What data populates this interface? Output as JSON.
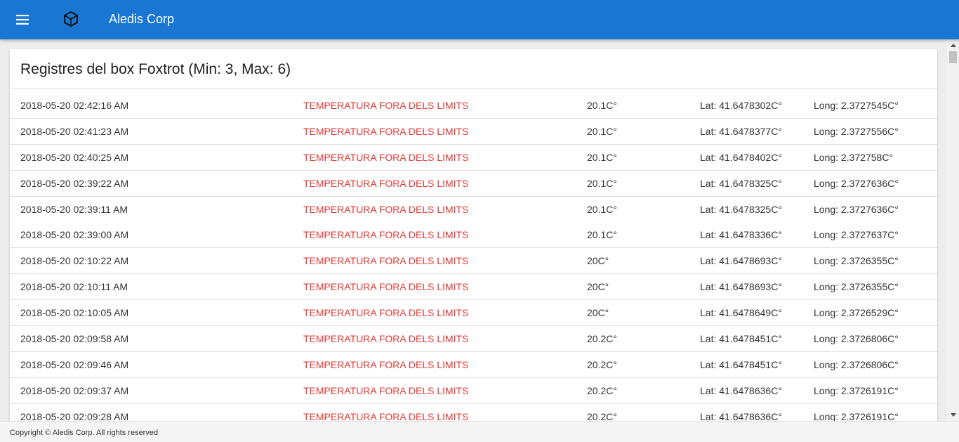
{
  "appbar": {
    "title": "Aledis Corp",
    "menu_icon": "hamburger-menu-icon",
    "logo_icon": "cube-icon",
    "color": "#1976d2"
  },
  "card": {
    "title": "Registres del box Foxtrot (Min: 3, Max: 6)"
  },
  "records": [
    {
      "date": "2018-05-20 02:42:16 AM",
      "status": "TEMPERATURA FORA DELS LIMITS",
      "temp": "20.1C°",
      "lat": "Lat: 41.6478302C°",
      "long": "Long: 2.3727545C°"
    },
    {
      "date": "2018-05-20 02:41:23 AM",
      "status": "TEMPERATURA FORA DELS LIMITS",
      "temp": "20.1C°",
      "lat": "Lat: 41.6478377C°",
      "long": "Long: 2.3727556C°"
    },
    {
      "date": "2018-05-20 02:40:25 AM",
      "status": "TEMPERATURA FORA DELS LIMITS",
      "temp": "20.1C°",
      "lat": "Lat: 41.6478402C°",
      "long": "Long: 2.372758C°"
    },
    {
      "date": "2018-05-20 02:39:22 AM",
      "status": "TEMPERATURA FORA DELS LIMITS",
      "temp": "20.1C°",
      "lat": "Lat: 41.6478325C°",
      "long": "Long: 2.3727636C°"
    },
    {
      "date": "2018-05-20 02:39:11 AM",
      "status": "TEMPERATURA FORA DELS LIMITS",
      "temp": "20.1C°",
      "lat": "Lat: 41.6478325C°",
      "long": "Long: 2.3727636C°"
    },
    {
      "date": "2018-05-20 02:39:00 AM",
      "status": "TEMPERATURA FORA DELS LIMITS",
      "temp": "20.1C°",
      "lat": "Lat: 41.6478336C°",
      "long": "Long: 2.3727637C°"
    },
    {
      "date": "2018-05-20 02:10:22 AM",
      "status": "TEMPERATURA FORA DELS LIMITS",
      "temp": "20C°",
      "lat": "Lat: 41.6478693C°",
      "long": "Long: 2.3726355C°"
    },
    {
      "date": "2018-05-20 02:10:11 AM",
      "status": "TEMPERATURA FORA DELS LIMITS",
      "temp": "20C°",
      "lat": "Lat: 41.6478693C°",
      "long": "Long: 2.3726355C°"
    },
    {
      "date": "2018-05-20 02:10:05 AM",
      "status": "TEMPERATURA FORA DELS LIMITS",
      "temp": "20C°",
      "lat": "Lat: 41.6478649C°",
      "long": "Long: 2.3726529C°"
    },
    {
      "date": "2018-05-20 02:09:58 AM",
      "status": "TEMPERATURA FORA DELS LIMITS",
      "temp": "20.2C°",
      "lat": "Lat: 41.6478451C°",
      "long": "Long: 2.3726806C°"
    },
    {
      "date": "2018-05-20 02:09:46 AM",
      "status": "TEMPERATURA FORA DELS LIMITS",
      "temp": "20.2C°",
      "lat": "Lat: 41.6478451C°",
      "long": "Long: 2.3726806C°"
    },
    {
      "date": "2018-05-20 02:09:37 AM",
      "status": "TEMPERATURA FORA DELS LIMITS",
      "temp": "20.2C°",
      "lat": "Lat: 41.6478636C°",
      "long": "Long: 2.3726191C°"
    },
    {
      "date": "2018-05-20 02:09:28 AM",
      "status": "TEMPERATURA FORA DELS LIMITS",
      "temp": "20.2C°",
      "lat": "Lat: 41.6478636C°",
      "long": "Long: 2.3726191C°"
    }
  ],
  "colors": {
    "status_alert": "#e53935"
  },
  "footer": {
    "text": "Copyright © Aledis Corp. All rights reserved"
  }
}
